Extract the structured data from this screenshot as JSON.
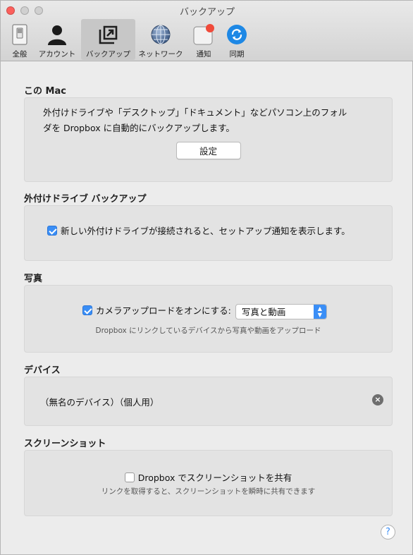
{
  "window": {
    "title": "バックアップ"
  },
  "toolbar": {
    "tabs": [
      {
        "label": "全般",
        "icon": "general-switch-icon"
      },
      {
        "label": "アカウント",
        "icon": "account-person-icon"
      },
      {
        "label": "バックアップ",
        "icon": "backup-icon",
        "active": true
      },
      {
        "label": "ネットワーク",
        "icon": "network-globe-icon"
      },
      {
        "label": "通知",
        "icon": "notification-icon"
      },
      {
        "label": "同期",
        "icon": "sync-icon"
      }
    ]
  },
  "this_mac": {
    "title": "この Mac",
    "description_line1": "外付けドライブや「デスクトップ」「ドキュメント」などパソコン上のフォル",
    "description_line2": "ダを Dropbox に自動的にバックアップします。",
    "settings_button": "設定"
  },
  "external_drive": {
    "title": "外付けドライブ バックアップ",
    "checkbox_label": "新しい外付けドライブが接続されると、セットアップ通知を表示します。",
    "checked": true
  },
  "photos": {
    "title": "写真",
    "checkbox_label": "カメラアップロードをオンにする:",
    "checked": true,
    "select_value": "写真と動画",
    "hint": "Dropbox にリンクしているデバイスから写真や動画をアップロード"
  },
  "devices": {
    "title": "デバイス",
    "device_name": "（無名のデバイス）（個人用）"
  },
  "screenshots": {
    "title": "スクリーンショット",
    "checkbox_label": "Dropbox でスクリーンショットを共有",
    "checked": false,
    "hint": "リンクを取得すると、スクリーンショットを瞬時に共有できます"
  },
  "help": {
    "label": "?"
  },
  "colors": {
    "accent": "#3a8ef6",
    "close": "#fc605c",
    "notification_dot": "#f04a3a"
  }
}
